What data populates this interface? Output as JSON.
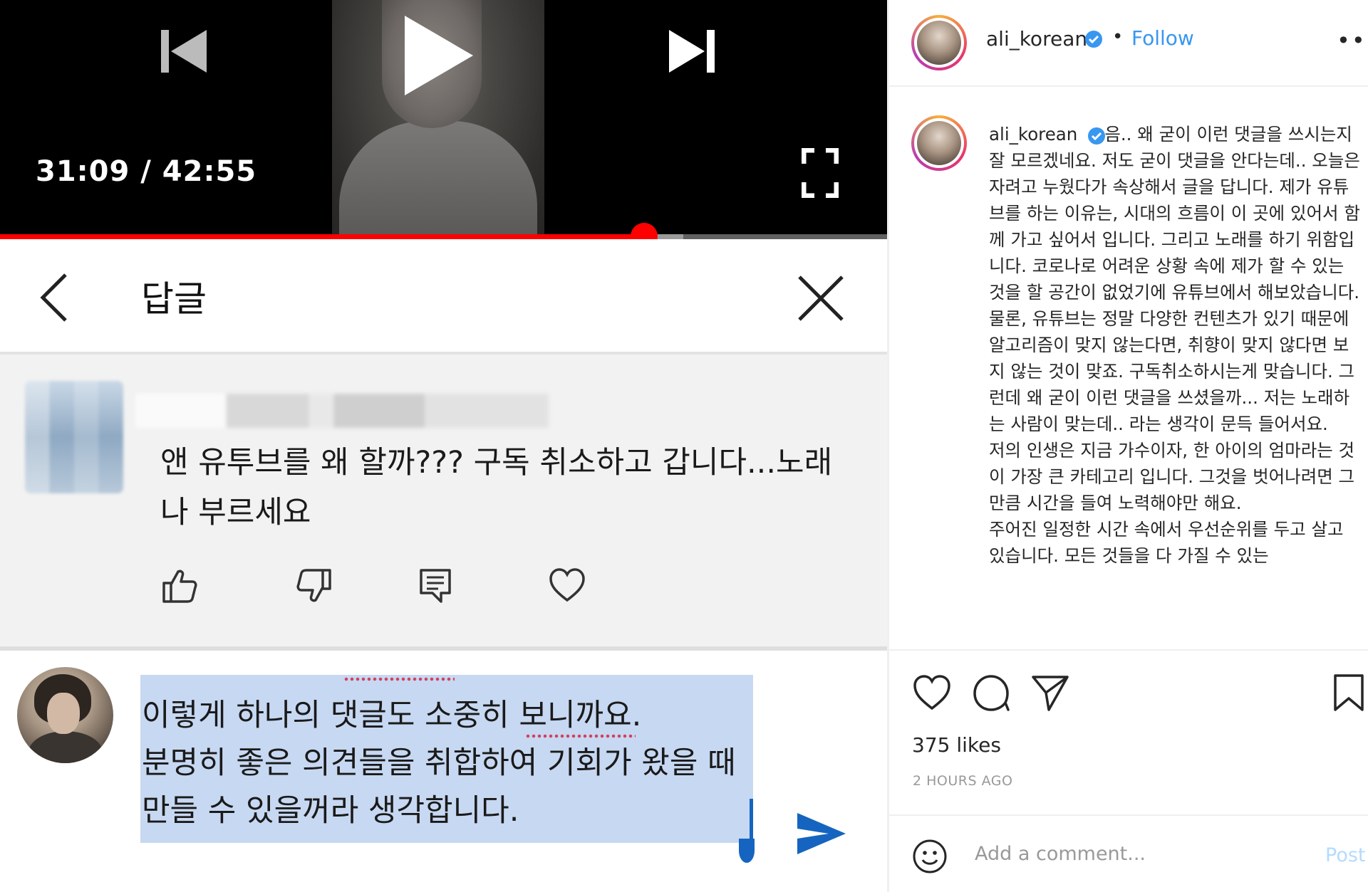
{
  "youtube": {
    "player": {
      "current_time": "31:09",
      "duration": "42:55",
      "progress_fraction": 0.726,
      "buffered_fraction": 0.77
    },
    "reply_header": {
      "title": "답글"
    },
    "comment": {
      "text": "앤 유투브를 왜 할까??? 구독 취소하고 갑니다...노래나 부르세요"
    },
    "reply_input": {
      "value_lines": [
        "이렇게 하나의 댓글도 소중히 보니까요.",
        "분명히 좋은 의견들을 취합하여 기회가 왔을 때",
        "만들 수 있을꺼라 생각합니다."
      ]
    },
    "colors": {
      "progress": "#ff0000",
      "selection": "#c7d8f2",
      "send": "#1565c0"
    }
  },
  "instagram": {
    "header": {
      "username": "ali_korean",
      "separator": "•",
      "follow_label": "Follow",
      "more_label": "•••"
    },
    "caption": {
      "username": "ali_korean",
      "paragraphs": [
        "음.. 왜 굳이 이런 댓글을 쓰시는지 잘 모르겠네요. 저도 굳이 댓글을 안다는데.. 오늘은 자려고 누웠다가 속상해서 글을 답니다. 제가 유튜브를 하는 이유는, 시대의 흐름이 이 곳에 있어서 함께 가고 싶어서 입니다. 그리고 노래를 하기 위함입니다. 코로나로 어려운 상황 속에 제가 할 수 있는 것을 할 공간이 없었기에 유튜브에서 해보았습니다. 물론, 유튜브는 정말 다양한 컨텐츠가 있기 때문에 알고리즘이 맞지 않는다면, 취향이 맞지 않다면 보지 않는 것이 맞죠. 구독취소하시는게 맞습니다. 그런데 왜 굳이 이런 댓글을 쓰셨을까... 저는 노래하는 사람이 맞는데.. 라는 생각이 문득 들어서요.",
        "저의 인생은 지금 가수이자, 한 아이의 엄마라는 것이 가장 큰 카테고리 입니다. 그것을 벗어나려면 그만큼 시간을 들여 노력해야만 해요.",
        "주어진 일정한 시간 속에서 우선순위를 두고 살고 있습니다. 모든 것들을 다 가질 수 있는"
      ]
    },
    "likes": "375 likes",
    "time_ago": "2 HOURS AGO",
    "comment_box": {
      "placeholder": "Add a comment...",
      "post_label": "Post"
    },
    "colors": {
      "link": "#3897f0",
      "verified": "#3897f0"
    }
  }
}
